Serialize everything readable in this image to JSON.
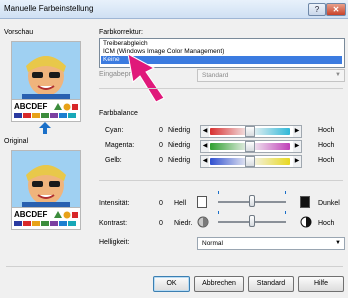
{
  "window": {
    "title": "Manuelle Farbeinstellung",
    "help_glyph": "?",
    "close_glyph": "✕"
  },
  "preview": {
    "label": "Vorschau",
    "original_label": "Original",
    "sample_text": "ABCDEF",
    "swatch_colors": [
      "#2a3aa0",
      "#d8282a",
      "#e8a218",
      "#3c8c3c",
      "#7a40a0",
      "#1c7fd0",
      "#18a8b8"
    ]
  },
  "color_correction": {
    "label": "Farbkorrektur:",
    "options": [
      "Treiberabgleich",
      "ICM (Windows Image Color Management)",
      "Keine"
    ],
    "selected": "Keine"
  },
  "input_profile": {
    "label": "Eingabeprofil:",
    "value": "Standard"
  },
  "color_balance": {
    "label": "Farbbalance",
    "low_label": "Niedrig",
    "high_label": "Hoch",
    "rows": [
      {
        "name": "Cyan:",
        "value": "0",
        "level": 0.5,
        "low_color": "#d83030",
        "high_color": "#30b8d8"
      },
      {
        "name": "Magenta:",
        "value": "0",
        "level": 0.5,
        "low_color": "#30a030",
        "high_color": "#c040b8"
      },
      {
        "name": "Gelb:",
        "value": "0",
        "level": 0.5,
        "low_color": "#3050d0",
        "high_color": "#e8d820"
      }
    ]
  },
  "intensity": {
    "label": "Intensität:",
    "value": "0",
    "low_label": "Hell",
    "high_label": "Dunkel",
    "level": 0.5
  },
  "contrast": {
    "label": "Kontrast:",
    "value": "0",
    "low_label": "Niedr.",
    "high_label": "Hoch",
    "level": 0.5
  },
  "brightness": {
    "label": "Helligkeit:",
    "value": "Normal"
  },
  "buttons": {
    "ok": "OK",
    "cancel": "Abbrechen",
    "defaults": "Standard",
    "help": "Hilfe"
  },
  "colors": {
    "selection": "#3b7be0",
    "annotation_arrow": "#e0187a",
    "arrow_icon": "#1a6fc8"
  }
}
